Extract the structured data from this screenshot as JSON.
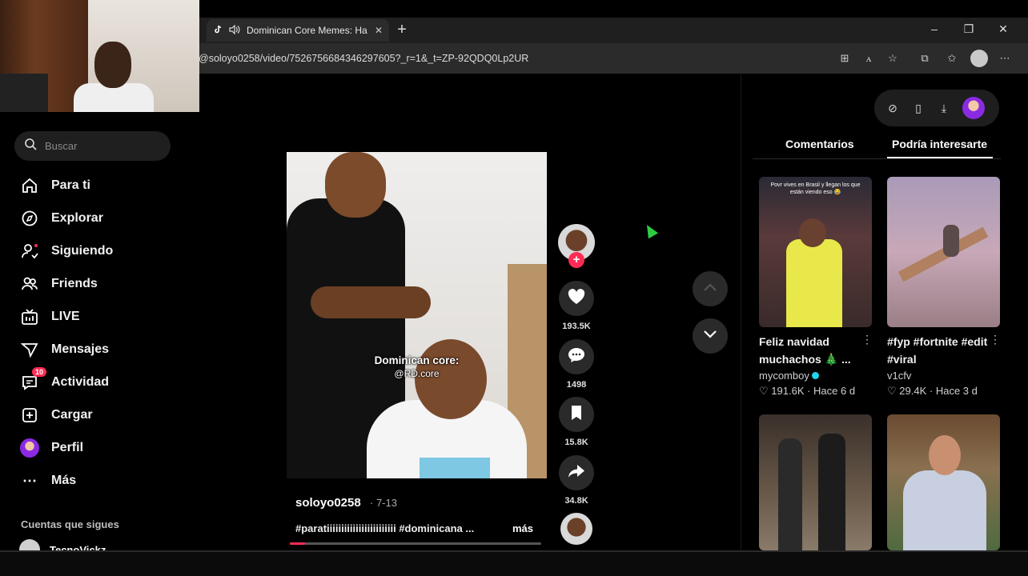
{
  "browser": {
    "tab_title": "Dominican Core Memes: Ha",
    "url": "@soloyo0258/video/7526756684346297605?_r=1&_t=ZP-92QDQ0Lp2UR",
    "new_tab": "+",
    "minimize": "–",
    "restore": "❐",
    "close": "✕"
  },
  "sidebar": {
    "search_placeholder": "Buscar",
    "items": [
      {
        "label": "Para ti",
        "icon": "home-icon"
      },
      {
        "label": "Explorar",
        "icon": "compass-icon"
      },
      {
        "label": "Siguiendo",
        "icon": "following-icon"
      },
      {
        "label": "Friends",
        "icon": "friends-icon"
      },
      {
        "label": "LIVE",
        "icon": "live-icon"
      },
      {
        "label": "Mensajes",
        "icon": "messages-icon"
      },
      {
        "label": "Actividad",
        "icon": "activity-icon",
        "badge": "10"
      },
      {
        "label": "Cargar",
        "icon": "upload-icon"
      },
      {
        "label": "Perfil",
        "icon": "profile-avatar"
      },
      {
        "label": "Más",
        "icon": "more-icon"
      }
    ],
    "following_title": "Cuentas que sigues",
    "following": [
      {
        "name": "TecnoVickz"
      }
    ]
  },
  "video": {
    "caption_line1": "Dominican core:",
    "caption_line2": "@RD.core",
    "author": "soloyo0258",
    "date": "· 7-13",
    "description": "#paratiiiiiiiiiiiiiiiiiiiiiiii #dominicana ...",
    "more": "más",
    "progress": 0.06
  },
  "actions": {
    "likes": "193.5K",
    "comments": "1498",
    "saves": "15.8K",
    "shares": "34.8K"
  },
  "right_panel": {
    "tabs": [
      "Comentarios",
      "Podría interesarte"
    ],
    "active_tab": 1,
    "cards": [
      {
        "title": "Feliz navidad muchachos 🎄 ...",
        "author": "mycomboy",
        "verified": true,
        "likes": "191.6K",
        "age": "Hace 6 d",
        "overlay": "Povr vives en Brasil y llegan los que están viendo eso 😂"
      },
      {
        "title": "#fyp #fortnite #edit #viral",
        "author": "v1cfv",
        "verified": false,
        "likes": "29.4K",
        "age": "Hace 3 d"
      },
      {
        "title": "",
        "author": "",
        "likes": "",
        "age": ""
      },
      {
        "title": "",
        "author": "",
        "likes": "",
        "age": ""
      }
    ]
  },
  "colors": {
    "accent": "#fe2c55",
    "background": "#000000",
    "panel": "#1f1f1f"
  }
}
